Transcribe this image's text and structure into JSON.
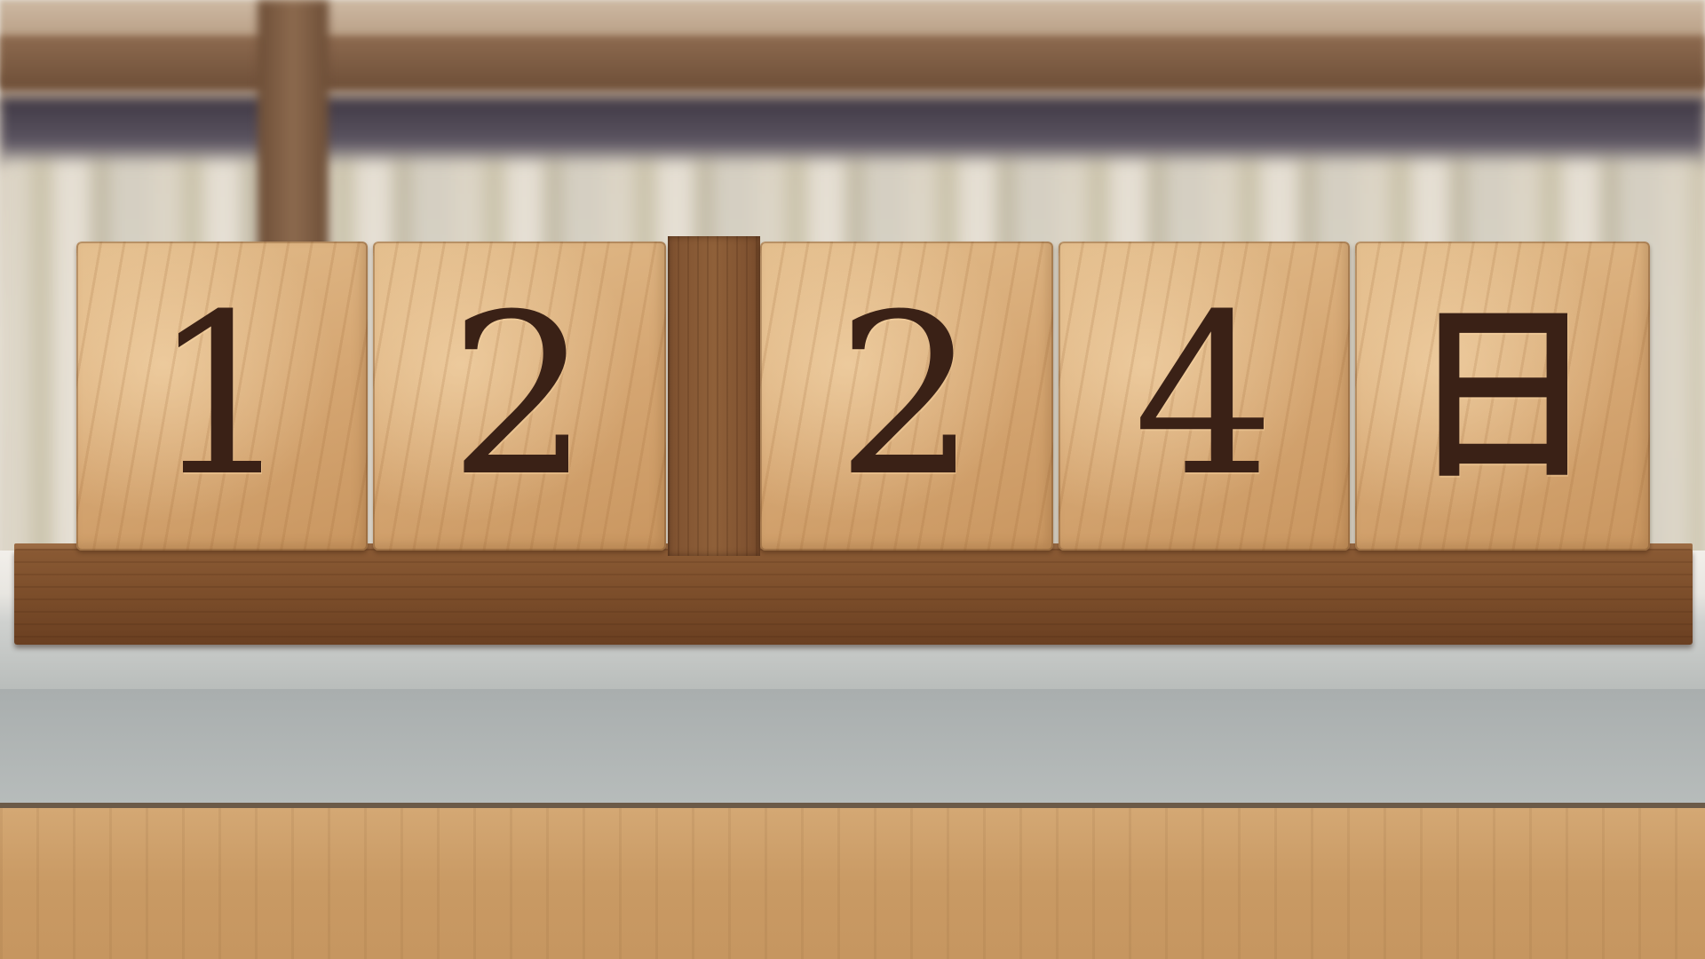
{
  "calendar": {
    "blocks": [
      {
        "glyph": "1"
      },
      {
        "glyph": "2"
      },
      {
        "glyph": "2"
      },
      {
        "glyph": "4"
      },
      {
        "glyph": "日"
      }
    ]
  }
}
